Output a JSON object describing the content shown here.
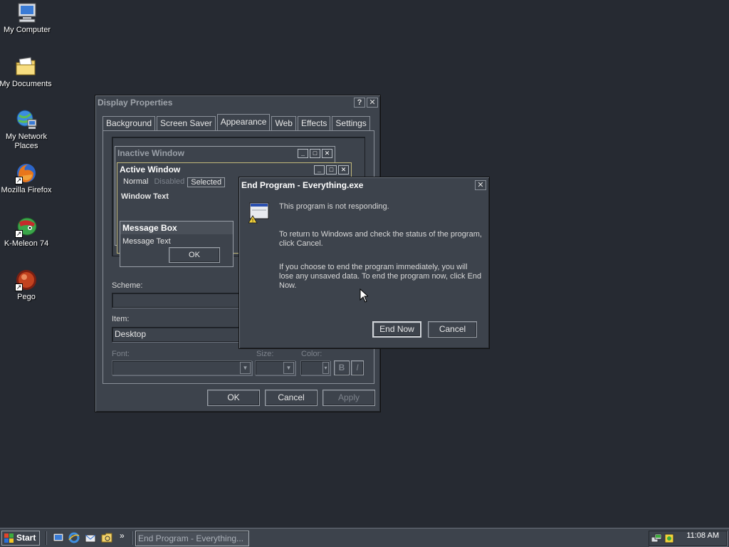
{
  "desktop": {
    "icons": [
      {
        "label": "My Computer",
        "icon": "computer-icon"
      },
      {
        "label": "My Documents",
        "icon": "folder-icon"
      },
      {
        "label": "My Network Places",
        "icon": "network-icon"
      },
      {
        "label": "Mozilla Firefox",
        "icon": "firefox-icon"
      },
      {
        "label": "K-Meleon 74",
        "icon": "kmeleon-icon"
      },
      {
        "label": "Pego",
        "icon": "pego-icon"
      }
    ]
  },
  "display_properties": {
    "title": "Display Properties",
    "tabs": [
      "Background",
      "Screen Saver",
      "Appearance",
      "Web",
      "Effects",
      "Settings"
    ],
    "active_tab": "Appearance",
    "preview": {
      "inactive_title": "Inactive Window",
      "active_title": "Active Window",
      "menu_normal": "Normal",
      "menu_disabled": "Disabled",
      "menu_selected": "Selected",
      "window_text": "Window Text",
      "msgbox_title": "Message Box",
      "msgbox_text": "Message Text",
      "msgbox_ok": "OK"
    },
    "scheme_label": "Scheme:",
    "scheme_value": "",
    "item_label": "Item:",
    "item_value": "Desktop",
    "font_label": "Font:",
    "size_label": "Size:",
    "color_label": "Color:",
    "bold_label": "B",
    "italic_label": "I",
    "ok_label": "OK",
    "cancel_label": "Cancel",
    "apply_label": "Apply"
  },
  "end_program": {
    "title": "End Program - Everything.exe",
    "line1": "This program is not responding.",
    "para2": "To return to Windows and check the status of the program, click Cancel.",
    "para3": "If you choose to end the program immediately, you will lose any unsaved data. To end the program now, click End Now.",
    "end_now_label": "End Now",
    "cancel_label": "Cancel"
  },
  "taskbar": {
    "start_label": "Start",
    "quicklaunch_more": "»",
    "task_label": "End Program - Everything...",
    "clock": "11:08 AM"
  },
  "colors": {
    "desktop": "#262a32",
    "window": "#3d434c",
    "active_title": "#3d434c"
  }
}
